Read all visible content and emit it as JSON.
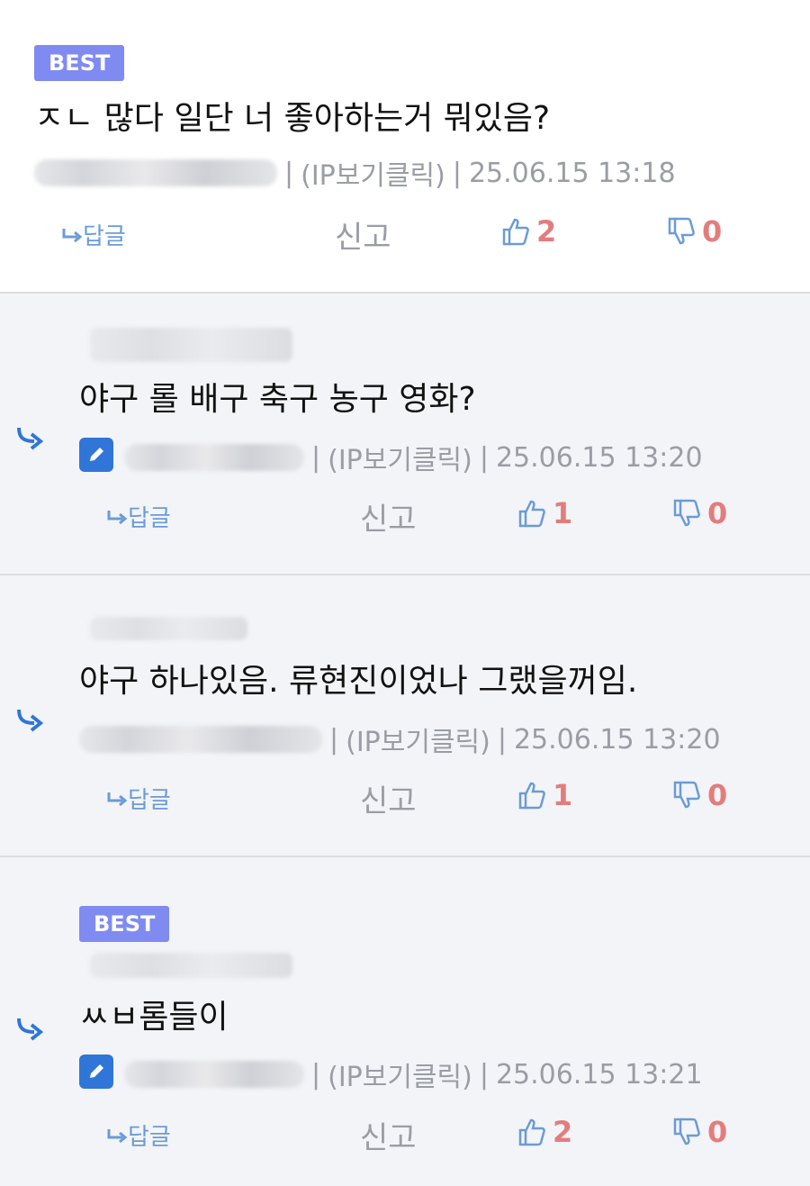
{
  "colors": {
    "accent": "#2f76d8",
    "best": "#7f8bf0",
    "vote_count": "#e37d7d",
    "icon": "#6b9bd6",
    "muted": "#9a9da4"
  },
  "comments": [
    {
      "best": "BEST",
      "text": "ㅈㄴ 많다 일단 너 좋아하는거 뭐있음?",
      "ip": "(IP보기클릭)",
      "date": "25.06.15 13:18",
      "reply": "답글",
      "report": "신고",
      "likes": "2",
      "dislikes": "0"
    },
    {
      "text": "야구 롤 배구 축구 농구 영화?",
      "ip": "(IP보기클릭)",
      "date": "25.06.15 13:20",
      "reply": "답글",
      "report": "신고",
      "likes": "1",
      "dislikes": "0"
    },
    {
      "text": "야구 하나있음. 류현진이었나 그랬을꺼임.",
      "ip": "(IP보기클릭)",
      "date": "25.06.15 13:20",
      "reply": "답글",
      "report": "신고",
      "likes": "1",
      "dislikes": "0"
    },
    {
      "best": "BEST",
      "text": "ㅆㅂ롬들이",
      "ip": "(IP보기클릭)",
      "date": "25.06.15 13:21",
      "reply": "답글",
      "report": "신고",
      "likes": "2",
      "dislikes": "0"
    }
  ],
  "separator": "|",
  "icons": {
    "reply": "reply-arrow-icon",
    "edit": "pencil-icon",
    "like": "thumbs-up-icon",
    "dislike": "thumbs-down-icon"
  }
}
